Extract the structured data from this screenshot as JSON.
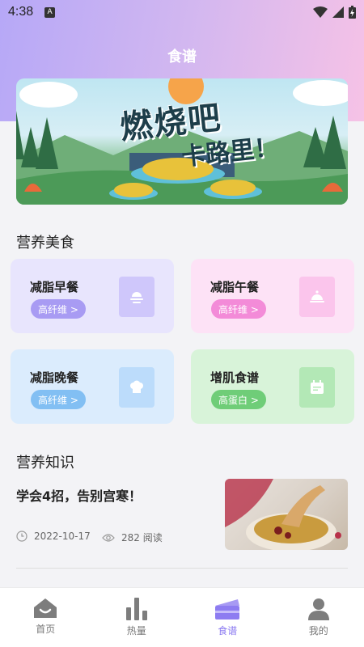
{
  "status_bar": {
    "time": "4:38",
    "indicator": "A"
  },
  "page": {
    "title": "食谱"
  },
  "banner": {
    "title": "燃烧吧",
    "subtitle": "卡路里！"
  },
  "sections": {
    "nutrition_food": "营养美食",
    "nutrition_knowledge": "营养知识"
  },
  "cards": [
    {
      "title": "减脂早餐",
      "badge": "高纤维 >",
      "icon": "sunrise-icon",
      "bg": "#e8e5fd",
      "badge_color": "#a89bf3",
      "icon_bg": "#cfc7fb"
    },
    {
      "title": "减脂午餐",
      "badge": "高纤维 >",
      "icon": "cloche-icon",
      "bg": "#fde2f6",
      "badge_color": "#f38bd8",
      "icon_bg": "#fbc5ec"
    },
    {
      "title": "减脂晚餐",
      "badge": "高纤维 >",
      "icon": "chef-hat-icon",
      "bg": "#dbecfd",
      "badge_color": "#82bff3",
      "icon_bg": "#bcdcfb"
    },
    {
      "title": "增肌食谱",
      "badge": "高蛋白 >",
      "icon": "calendar-icon",
      "bg": "#d8f3d9",
      "badge_color": "#6fcd78",
      "icon_bg": "#b3e8b6"
    }
  ],
  "article": {
    "title": "学会4招，告别宫寒！",
    "date": "2022-10-17",
    "views": "282 阅读"
  },
  "tabbar": [
    {
      "label": "首页",
      "icon": "home-icon",
      "active": false
    },
    {
      "label": "热量",
      "icon": "bar-chart-icon",
      "active": false
    },
    {
      "label": "食谱",
      "icon": "cake-icon",
      "active": true
    },
    {
      "label": "我的",
      "icon": "user-icon",
      "active": false
    }
  ]
}
